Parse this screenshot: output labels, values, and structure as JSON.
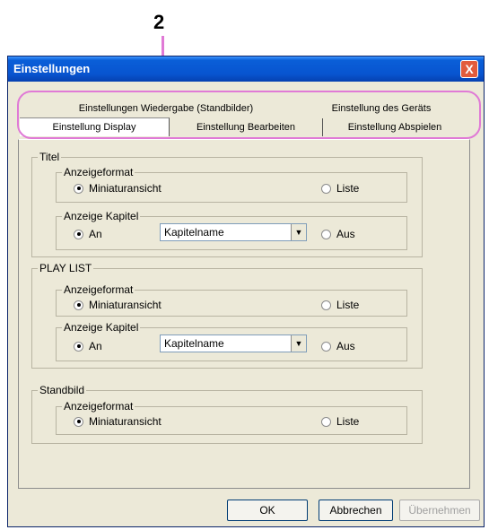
{
  "callout": "2",
  "window": {
    "title": "Einstellungen",
    "close_label": "X"
  },
  "tabs": {
    "row1": [
      "Einstellungen Wiedergabe (Standbilder)",
      "Einstellung des Geräts"
    ],
    "row2": [
      "Einstellung Display",
      "Einstellung Bearbeiten",
      "Einstellung Abspielen"
    ]
  },
  "sections": {
    "titel": {
      "label": "Titel",
      "format_label": "Anzeigeformat",
      "format_opt1": "Miniaturansicht",
      "format_opt2": "Liste",
      "kapitel_label": "Anzeige Kapitel",
      "kapitel_on": "An",
      "kapitel_select": "Kapitelname",
      "kapitel_off": "Aus"
    },
    "playlist": {
      "label": "PLAY LIST",
      "format_label": "Anzeigeformat",
      "format_opt1": "Miniaturansicht",
      "format_opt2": "Liste",
      "kapitel_label": "Anzeige Kapitel",
      "kapitel_on": "An",
      "kapitel_select": "Kapitelname",
      "kapitel_off": "Aus"
    },
    "standbild": {
      "label": "Standbild",
      "format_label": "Anzeigeformat",
      "format_opt1": "Miniaturansicht",
      "format_opt2": "Liste"
    }
  },
  "buttons": {
    "ok": "OK",
    "cancel": "Abbrechen",
    "apply": "Übernehmen"
  }
}
